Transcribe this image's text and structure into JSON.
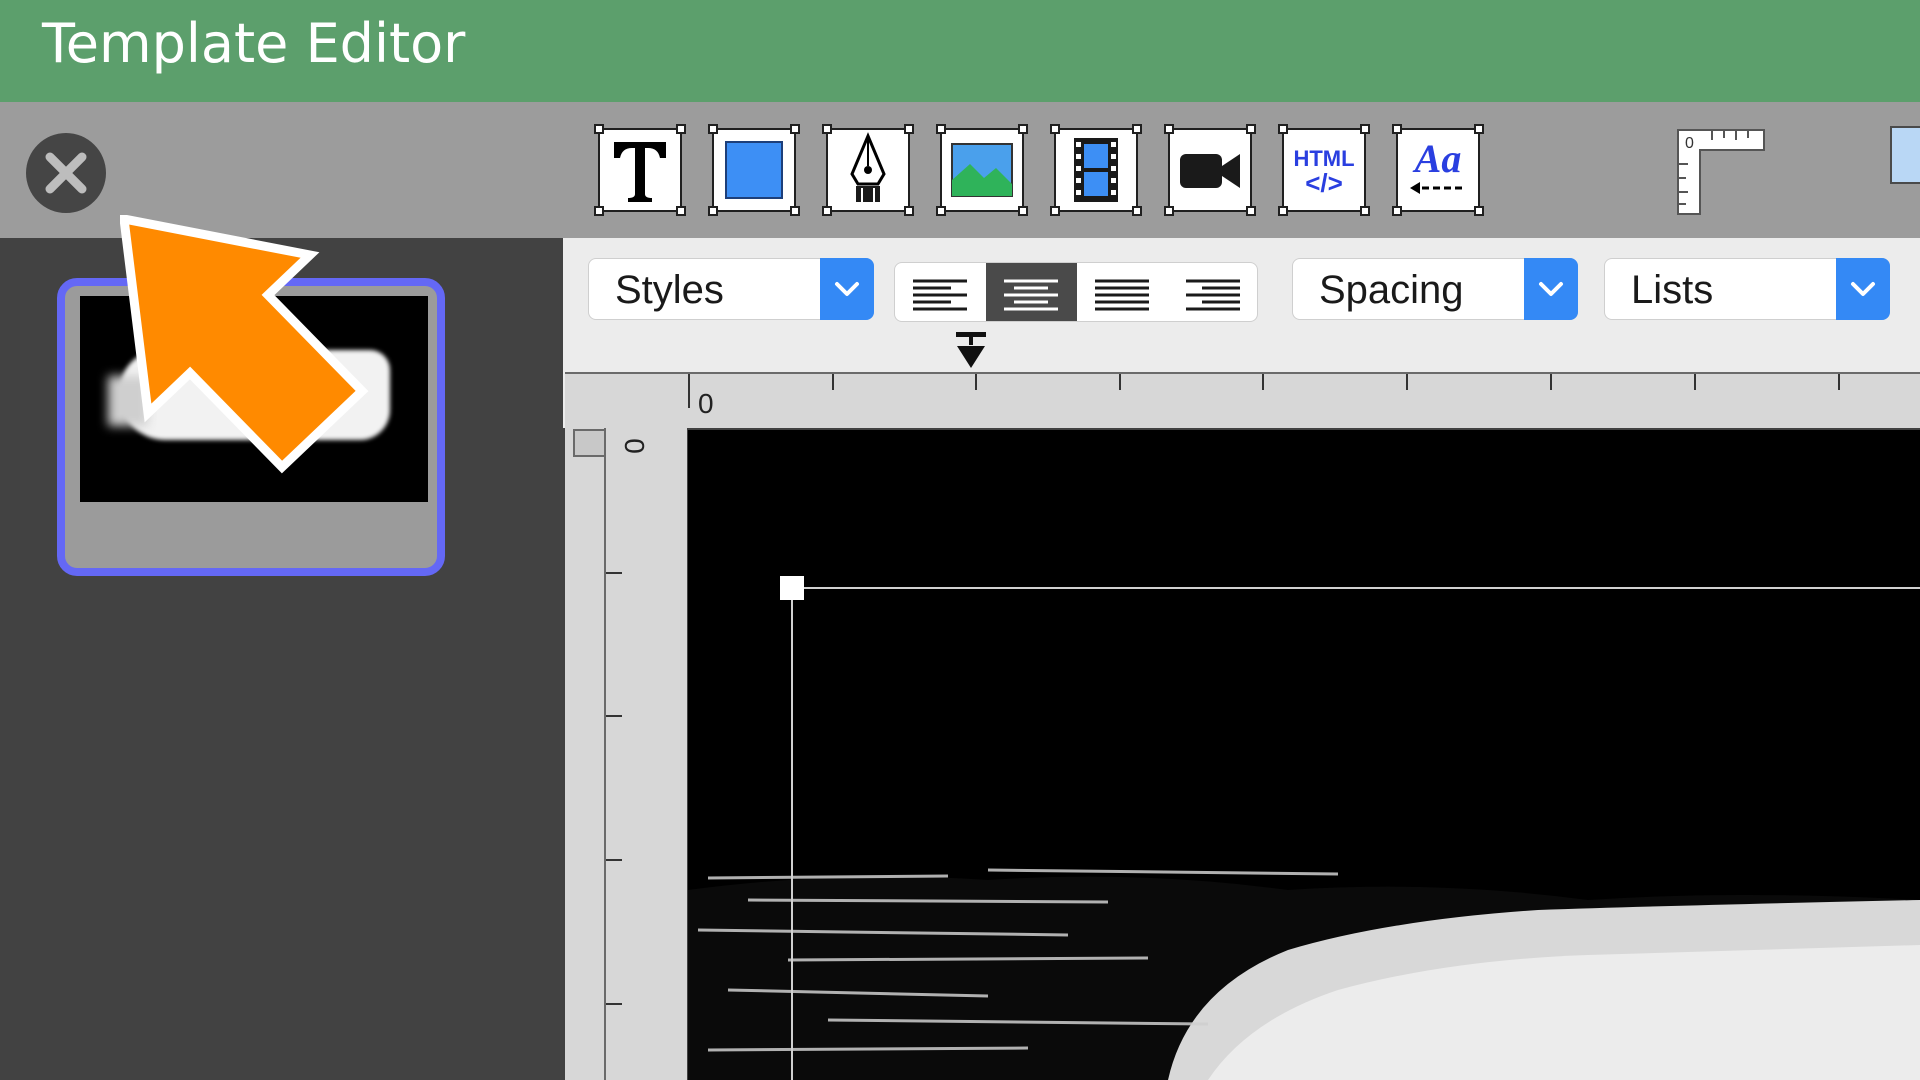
{
  "window": {
    "title": "Template Editor"
  },
  "toolbar": {
    "tools": [
      {
        "name": "text-tool",
        "icon": "text-T-icon"
      },
      {
        "name": "rectangle-tool",
        "icon": "blue-rectangle-icon"
      },
      {
        "name": "pen-tool",
        "icon": "pen-nib-icon"
      },
      {
        "name": "image-tool",
        "icon": "landscape-image-icon"
      },
      {
        "name": "film-tool",
        "icon": "film-strip-icon"
      },
      {
        "name": "video-tool",
        "icon": "video-camera-icon"
      },
      {
        "name": "html-tool",
        "icon": "html-code-icon",
        "label_top": "HTML",
        "label_bottom": "</>"
      },
      {
        "name": "text-style-tool",
        "icon": "text-style-icon",
        "label": "Aa"
      }
    ],
    "ruler_label": "0"
  },
  "format_bar": {
    "styles_label": "Styles",
    "spacing_label": "Spacing",
    "lists_label": "Lists",
    "alignment": {
      "options": [
        "left",
        "center",
        "justify",
        "right"
      ],
      "selected": "center"
    }
  },
  "rulers": {
    "horizontal_zero": "0",
    "vertical_zero": "0"
  },
  "colors": {
    "titlebar": "#5c9f6c",
    "accent": "#3489f5",
    "thumb_border": "#6468f5",
    "cursor": "#ff8a00"
  }
}
